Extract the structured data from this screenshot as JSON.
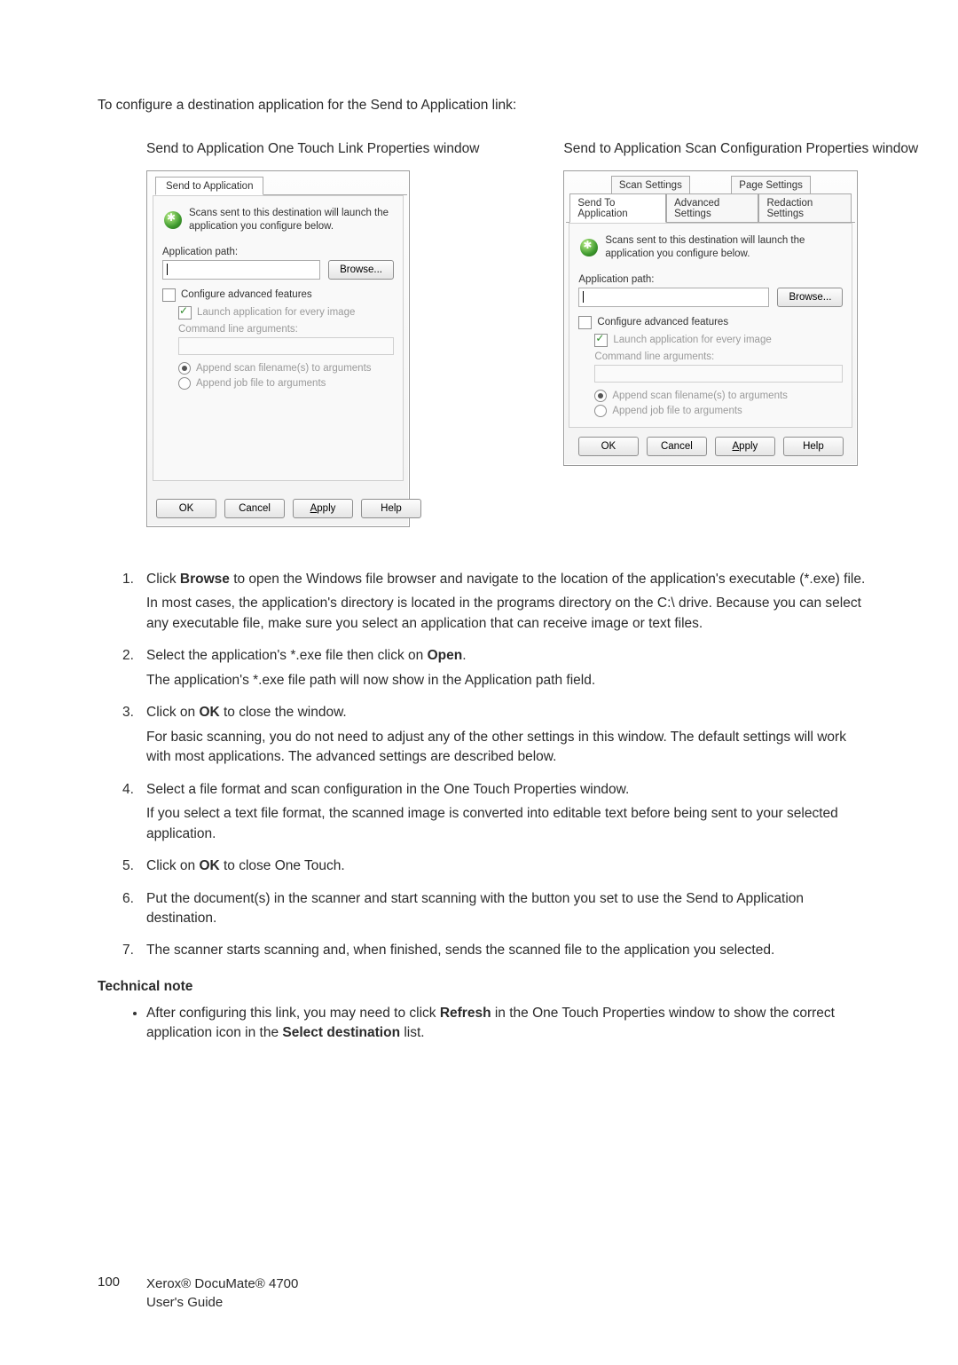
{
  "intro": "To configure a destination application for the Send to Application link:",
  "captions": {
    "left": "Send to Application One Touch Link Properties window",
    "right": "Send to Application Scan Configuration Properties window"
  },
  "winA": {
    "tab": "Send to Application",
    "desc": "Scans sent to this destination will launch the application you configure below.",
    "appPathLabel": "Application path:",
    "browse": "Browse...",
    "advCheck": "Configure advanced features",
    "launchEvery": "Launch application for every image",
    "cmdLabel": "Command line arguments:",
    "radio1": "Append scan filename(s) to arguments",
    "radio2": "Append job file to arguments",
    "buttons": {
      "ok": "OK",
      "cancel": "Cancel",
      "apply": "Apply",
      "help": "Help"
    }
  },
  "winB": {
    "tabs": {
      "scan": "Scan Settings",
      "page": "Page Settings",
      "sendto": "Send To Application",
      "advanced": "Advanced Settings",
      "redaction": "Redaction Settings"
    },
    "desc": "Scans sent to this destination will launch the application you configure below.",
    "appPathLabel": "Application path:",
    "browse": "Browse...",
    "advCheck": "Configure advanced features",
    "launchEvery": "Launch application for every image",
    "cmdLabel": "Command line arguments:",
    "radio1": "Append scan filename(s) to arguments",
    "radio2": "Append job file to arguments",
    "buttons": {
      "ok": "OK",
      "cancel": "Cancel",
      "apply": "Apply",
      "help": "Help"
    }
  },
  "steps": [
    {
      "a": "Click ",
      "b": "Browse",
      "c": " to open the Windows file browser and navigate to the location of the application's executable (*.exe) file.",
      "paras": [
        "In most cases, the application's directory is located in the programs directory on the C:\\ drive. Because you can select any executable file, make sure you select an application that can receive image or text files."
      ]
    },
    {
      "a": "Select the application's *.exe file then click on ",
      "b": "Open",
      "c": ".",
      "paras": [
        "The application's *.exe file path will now show in the Application path field."
      ]
    },
    {
      "a": "Click on ",
      "b": "OK",
      "c": " to close the window.",
      "paras": [
        "For basic scanning, you do not need to adjust any of the other settings in this window. The default settings will work with most applications. The advanced settings are described below."
      ]
    },
    {
      "a": "Select a file format and scan configuration in the One Touch Properties window.",
      "b": "",
      "c": "",
      "paras": [
        "If you select a text file format, the scanned image is converted into editable text before being sent to your selected application."
      ]
    },
    {
      "a": "Click on ",
      "b": "OK",
      "c": " to close One Touch.",
      "paras": []
    },
    {
      "a": "Put the document(s) in the scanner and start scanning with the button you set to use the Send to Application destination.",
      "b": "",
      "c": "",
      "paras": []
    },
    {
      "a": "The scanner starts scanning and, when finished, sends the scanned file to the application you selected.",
      "b": "",
      "c": "",
      "paras": []
    }
  ],
  "technote": {
    "title": "Technical note",
    "item": {
      "a": "After configuring this link, you may need to click ",
      "b": "Refresh",
      "c": " in the One Touch Properties window to show the correct application icon in the ",
      "d": "Select destination",
      "e": " list."
    }
  },
  "footer": {
    "page": "100",
    "line1": "Xerox® DocuMate® 4700",
    "line2": "User's Guide"
  }
}
